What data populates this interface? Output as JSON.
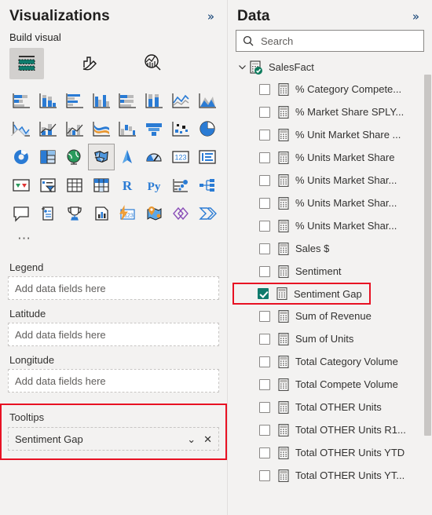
{
  "visualizations": {
    "title": "Visualizations",
    "collapse_label": "»",
    "build_visual_label": "Build visual",
    "tabs": [
      {
        "name": "build-visual-tab",
        "icon": "fields-build-icon",
        "selected": true
      },
      {
        "name": "format-visual-tab",
        "icon": "paintbrush-icon",
        "selected": false
      },
      {
        "name": "analytics-tab",
        "icon": "magnifier-chart-icon",
        "selected": false
      }
    ],
    "gallery": {
      "more_label": "⋯",
      "rows": [
        [
          {
            "name": "stacked-bar-chart",
            "icon": "stacked-bar-chart-icon"
          },
          {
            "name": "stacked-column-chart",
            "icon": "stacked-column-chart-icon"
          },
          {
            "name": "clustered-bar-chart",
            "icon": "clustered-bar-chart-icon"
          },
          {
            "name": "clustered-column-chart",
            "icon": "clustered-column-chart-icon"
          },
          {
            "name": "100-stacked-bar-chart",
            "icon": "hundred-stacked-bar-chart-icon"
          },
          {
            "name": "100-stacked-column-chart",
            "icon": "hundred-stacked-column-chart-icon"
          },
          {
            "name": "line-chart",
            "icon": "line-chart-icon"
          },
          {
            "name": "area-chart",
            "icon": "area-chart-icon"
          }
        ],
        [
          {
            "name": "stacked-area-chart",
            "icon": "stacked-area-chart-icon"
          },
          {
            "name": "line-and-stacked-column-chart",
            "icon": "line-stacked-column-chart-icon"
          },
          {
            "name": "line-and-clustered-column-chart",
            "icon": "line-clustered-column-chart-icon"
          },
          {
            "name": "ribbon-chart",
            "icon": "ribbon-chart-icon"
          },
          {
            "name": "waterfall-chart",
            "icon": "waterfall-chart-icon"
          },
          {
            "name": "funnel-chart",
            "icon": "funnel-chart-icon"
          },
          {
            "name": "scatter-chart",
            "icon": "scatter-chart-icon"
          },
          {
            "name": "pie-chart",
            "icon": "pie-chart-icon"
          }
        ],
        [
          {
            "name": "donut-chart",
            "icon": "donut-chart-icon"
          },
          {
            "name": "treemap",
            "icon": "treemap-icon"
          },
          {
            "name": "map",
            "icon": "globe-map-icon"
          },
          {
            "name": "filled-map",
            "icon": "filled-map-icon",
            "selected": true
          },
          {
            "name": "azure-map",
            "icon": "azure-map-arrow-icon"
          },
          {
            "name": "gauge",
            "icon": "gauge-icon"
          },
          {
            "name": "card",
            "icon": "card-123-icon"
          },
          {
            "name": "multi-row-card",
            "icon": "multi-row-card-icon"
          }
        ],
        [
          {
            "name": "kpi",
            "icon": "kpi-icon"
          },
          {
            "name": "slicer",
            "icon": "slicer-funnel-icon"
          },
          {
            "name": "table",
            "icon": "table-icon"
          },
          {
            "name": "matrix",
            "icon": "matrix-icon"
          },
          {
            "name": "r-script-visual",
            "icon": "r-script-icon",
            "text": "R"
          },
          {
            "name": "python-visual",
            "icon": "python-script-icon",
            "text": "Py"
          },
          {
            "name": "key-influencers",
            "icon": "key-influencers-icon"
          },
          {
            "name": "decomposition-tree",
            "icon": "decomposition-tree-icon"
          }
        ],
        [
          {
            "name": "qna-visual",
            "icon": "qna-speech-bubble-icon"
          },
          {
            "name": "smart-narrative",
            "icon": "smart-narrative-icon"
          },
          {
            "name": "metrics-visual",
            "icon": "trophy-icon"
          },
          {
            "name": "paginated-report",
            "icon": "paginated-report-icon"
          },
          {
            "name": "power-apps",
            "icon": "power-apps-icon"
          },
          {
            "name": "arcgis-maps",
            "icon": "arcgis-maps-icon"
          },
          {
            "name": "power-automate",
            "icon": "power-automate-icon"
          },
          {
            "name": "azure-stream-analytics",
            "icon": "azure-stream-icon"
          }
        ]
      ]
    },
    "wells": [
      {
        "name": "legend",
        "label": "Legend",
        "placeholder": "Add data fields here",
        "value": ""
      },
      {
        "name": "latitude",
        "label": "Latitude",
        "placeholder": "Add data fields here",
        "value": ""
      },
      {
        "name": "longitude",
        "label": "Longitude",
        "placeholder": "Add data fields here",
        "value": ""
      }
    ],
    "tooltips_well": {
      "label": "Tooltips",
      "value": "Sentiment Gap",
      "expand_icon": "chevron-down-icon",
      "remove_icon": "close-icon",
      "expand_label": "⌄",
      "remove_label": "✕",
      "highlight_color": "#e81123"
    }
  },
  "data": {
    "title": "Data",
    "collapse_label": "»",
    "search": {
      "placeholder": "Search",
      "value": ""
    },
    "table": {
      "name": "SalesFact",
      "expanded": true,
      "chevron_label": "⌄",
      "icon": "table-checked-icon"
    },
    "fields": [
      {
        "label": "% Category Compete...",
        "checked": false
      },
      {
        "label": "% Market Share SPLY...",
        "checked": false
      },
      {
        "label": "% Unit Market Share ...",
        "checked": false
      },
      {
        "label": "% Units Market Share",
        "checked": false
      },
      {
        "label": "% Units Market Shar...",
        "checked": false
      },
      {
        "label": "% Units Market Shar...",
        "checked": false
      },
      {
        "label": "% Units Market Shar...",
        "checked": false
      },
      {
        "label": "Sales $",
        "checked": false
      },
      {
        "label": "Sentiment",
        "checked": false
      },
      {
        "label": "Sentiment Gap",
        "checked": true,
        "highlighted": true
      },
      {
        "label": "Sum of Revenue",
        "checked": false
      },
      {
        "label": "Sum of Units",
        "checked": false
      },
      {
        "label": "Total Category Volume",
        "checked": false
      },
      {
        "label": "Total Compete Volume",
        "checked": false
      },
      {
        "label": "Total OTHER Units",
        "checked": false
      },
      {
        "label": "Total OTHER Units R1...",
        "checked": false
      },
      {
        "label": "Total OTHER Units YTD",
        "checked": false
      },
      {
        "label": "Total OTHER Units YT...",
        "checked": false
      }
    ],
    "scrollbar": {
      "name": "data-pane-scrollbar"
    }
  },
  "colors": {
    "accent_blue": "#2a7bd4",
    "teal": "#0f7b6c",
    "highlight_red": "#e81123",
    "panel_bg": "#f3f2f1"
  }
}
